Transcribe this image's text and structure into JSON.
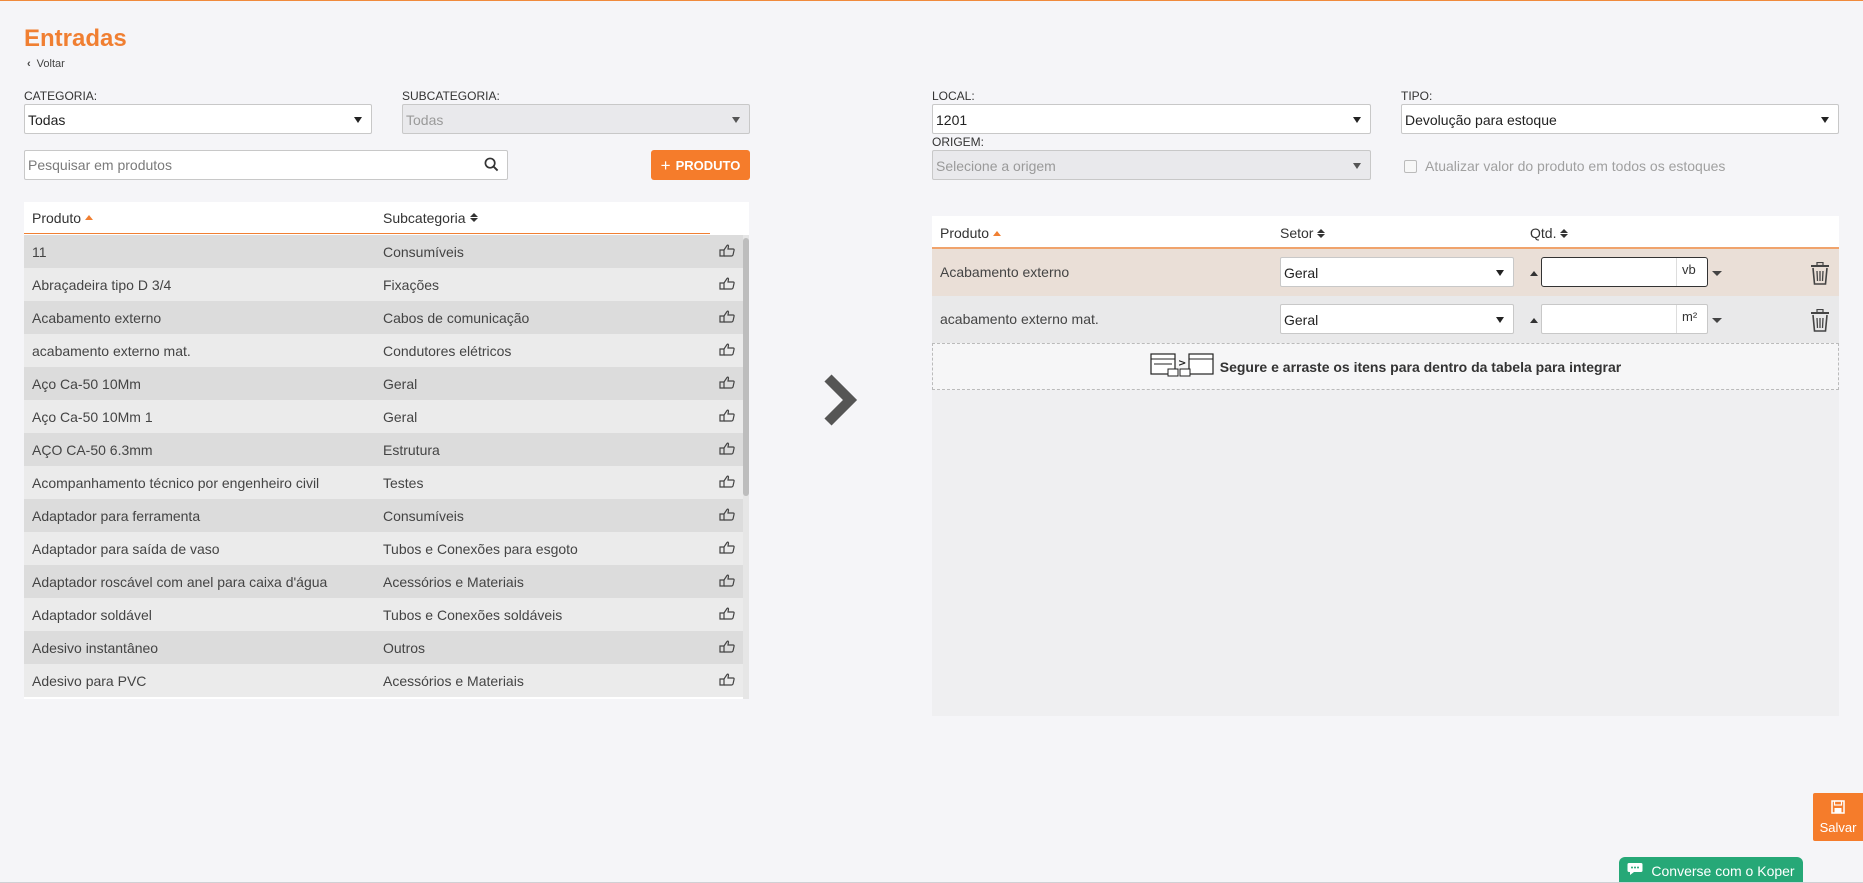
{
  "page": {
    "title": "Entradas",
    "back_label": "Voltar"
  },
  "filters": {
    "categoria_label": "CATEGORIA:",
    "categoria_value": "Todas",
    "subcategoria_label": "SUBCATEGORIA:",
    "subcategoria_value": "Todas",
    "search_placeholder": "Pesquisar em produtos",
    "add_product_label": "PRODUTO"
  },
  "product_table": {
    "headers": {
      "produto": "Produto",
      "subcategoria": "Subcategoria"
    },
    "rows": [
      {
        "produto": "11",
        "subcategoria": "Consumíveis"
      },
      {
        "produto": "Abraçadeira tipo D 3/4",
        "subcategoria": "Fixações"
      },
      {
        "produto": "Acabamento externo",
        "subcategoria": "Cabos de comunicação"
      },
      {
        "produto": "acabamento externo mat.",
        "subcategoria": "Condutores elétricos"
      },
      {
        "produto": "Aço Ca-50 10Mm",
        "subcategoria": "Geral"
      },
      {
        "produto": "Aço Ca-50 10Mm 1",
        "subcategoria": "Geral"
      },
      {
        "produto": "AÇO CA-50 6.3mm",
        "subcategoria": "Estrutura"
      },
      {
        "produto": "Acompanhamento técnico por engenheiro civil",
        "subcategoria": "Testes"
      },
      {
        "produto": "Adaptador para ferramenta",
        "subcategoria": "Consumíveis"
      },
      {
        "produto": "Adaptador para saída de vaso",
        "subcategoria": "Tubos e Conexões para esgoto"
      },
      {
        "produto": "Adaptador roscável com anel para caixa d'água",
        "subcategoria": "Acessórios e Materiais"
      },
      {
        "produto": "Adaptador soldável",
        "subcategoria": "Tubos e Conexões soldáveis"
      },
      {
        "produto": "Adesivo instantâneo",
        "subcategoria": "Outros"
      },
      {
        "produto": "Adesivo para PVC",
        "subcategoria": "Acessórios e Materiais"
      }
    ]
  },
  "entry": {
    "local_label": "LOCAL:",
    "local_value": "1201",
    "tipo_label": "TIPO:",
    "tipo_value": "Devolução para estoque",
    "origem_label": "ORIGEM:",
    "origem_placeholder": "Selecione a origem",
    "update_all_label": "Atualizar valor do produto em todos os estoques"
  },
  "entry_table": {
    "headers": {
      "produto": "Produto",
      "setor": "Setor",
      "qtd": "Qtd."
    },
    "rows": [
      {
        "produto": "Acabamento externo",
        "setor": "Geral",
        "qtd": "",
        "unit": "vb"
      },
      {
        "produto": "acabamento externo mat.",
        "setor": "Geral",
        "qtd": "",
        "unit": "m²"
      }
    ],
    "drop_hint": "Segure e arraste os itens para dentro da tabela para integrar"
  },
  "actions": {
    "save_label": "Salvar",
    "chat_label": "Converse com o Koper"
  },
  "colors": {
    "accent": "#f57c2b",
    "chat": "#26a877"
  }
}
